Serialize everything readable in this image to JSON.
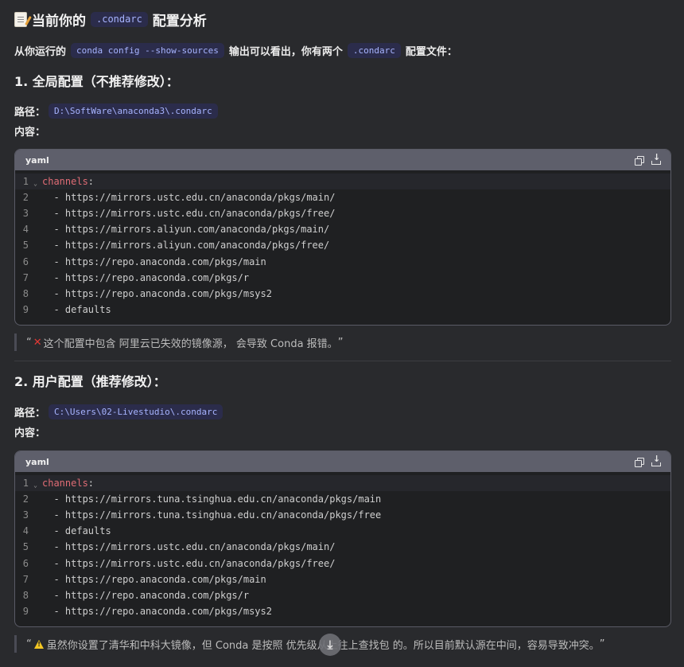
{
  "title": {
    "prefix": "当前你的",
    "code": ".condarc",
    "suffix": "配置分析"
  },
  "intro": {
    "p1": "从你运行的",
    "code1": "conda config --show-sources",
    "p2": "输出可以看出，你有两个",
    "code2": ".condarc",
    "p3": "配置文件："
  },
  "section1": {
    "heading": "1. 全局配置（不推荐修改）：",
    "path_label": "路径：",
    "path": "D:\\SoftWare\\anaconda3\\.condarc",
    "content_label": "内容：",
    "code": {
      "lang": "yaml",
      "lines": [
        {
          "n": "1",
          "key": "channels",
          "rest": ":"
        },
        {
          "n": "2",
          "text": "  - https://mirrors.ustc.edu.cn/anaconda/pkgs/main/"
        },
        {
          "n": "3",
          "text": "  - https://mirrors.ustc.edu.cn/anaconda/pkgs/free/"
        },
        {
          "n": "4",
          "text": "  - https://mirrors.aliyun.com/anaconda/pkgs/main/"
        },
        {
          "n": "5",
          "text": "  - https://mirrors.aliyun.com/anaconda/pkgs/free/"
        },
        {
          "n": "6",
          "text": "  - https://repo.anaconda.com/pkgs/main"
        },
        {
          "n": "7",
          "text": "  - https://repo.anaconda.com/pkgs/r"
        },
        {
          "n": "8",
          "text": "  - https://repo.anaconda.com/pkgs/msys2"
        },
        {
          "n": "9",
          "text": "  - defaults"
        }
      ]
    },
    "note_open": "“",
    "note": "这个配置中包含 阿里云已失效的镜像源， 会导致 Conda 报错。",
    "note_close": "”"
  },
  "section2": {
    "heading": "2. 用户配置（推荐修改）：",
    "path_label": "路径：",
    "path": "C:\\Users\\02-Livestudio\\.condarc",
    "content_label": "内容：",
    "code": {
      "lang": "yaml",
      "lines": [
        {
          "n": "1",
          "key": "channels",
          "rest": ":"
        },
        {
          "n": "2",
          "text": "  - https://mirrors.tuna.tsinghua.edu.cn/anaconda/pkgs/main"
        },
        {
          "n": "3",
          "text": "  - https://mirrors.tuna.tsinghua.edu.cn/anaconda/pkgs/free"
        },
        {
          "n": "4",
          "text": "  - defaults"
        },
        {
          "n": "5",
          "text": "  - https://mirrors.ustc.edu.cn/anaconda/pkgs/main/"
        },
        {
          "n": "6",
          "text": "  - https://mirrors.ustc.edu.cn/anaconda/pkgs/free/"
        },
        {
          "n": "7",
          "text": "  - https://repo.anaconda.com/pkgs/main"
        },
        {
          "n": "8",
          "text": "  - https://repo.anaconda.com/pkgs/r"
        },
        {
          "n": "9",
          "text": "  - https://repo.anaconda.com/pkgs/msys2"
        }
      ]
    },
    "note_open": "“",
    "note": "虽然你设置了清华和中科大镜像，但 Conda 是按照 优先级从上往上查找包 的。所以目前默认源在中间，容易导致冲突。",
    "note_close": "”"
  },
  "icons": {
    "title": "memo-icon",
    "copy": "copy-icon",
    "download": "download-icon",
    "error": "cross-mark-icon",
    "warning": "warning-icon",
    "scroll": "arrow-down-icon",
    "fold": "chevron-down-icon"
  },
  "glyphs": {
    "error": "✕",
    "fold": "⌄",
    "scroll": "⤓"
  },
  "colors": {
    "background": "#292a2d",
    "inline_code_bg": "#2b2c4b",
    "inline_code_text": "#a7b4ff",
    "yaml_key": "#e06c75",
    "error": "#e53935",
    "warning": "#f3c623"
  }
}
